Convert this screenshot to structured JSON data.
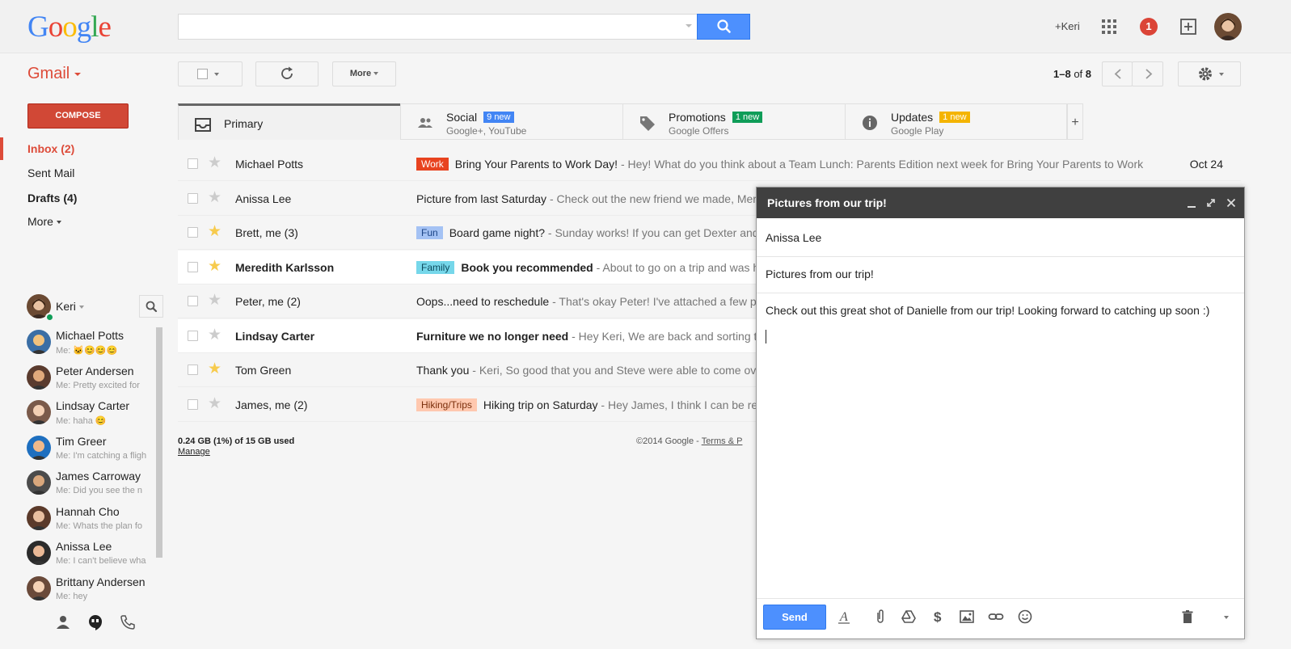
{
  "header": {
    "logo": "Google",
    "search": {
      "value": "",
      "placeholder": ""
    },
    "user_link": "+Keri",
    "notifications_count": "1"
  },
  "toolbar": {
    "app_label": "Gmail",
    "more_label": "More",
    "pager": {
      "range": "1–8",
      "of": "of",
      "total": "8"
    }
  },
  "nav": {
    "compose_label": "COMPOSE",
    "items": [
      {
        "label": "Inbox (2)",
        "active": true
      },
      {
        "label": "Sent Mail"
      },
      {
        "label": "Drafts (4)"
      },
      {
        "label": "More"
      }
    ]
  },
  "hangouts": {
    "me": "Keri",
    "contacts": [
      {
        "name": "Michael Potts",
        "message": "Me: 🐱😊😊😊"
      },
      {
        "name": "Peter Andersen",
        "message": "Me: Pretty excited for"
      },
      {
        "name": "Lindsay Carter",
        "message": "Me: haha 😊"
      },
      {
        "name": "Tim Greer",
        "message": "Me: I'm catching a fligh"
      },
      {
        "name": "James Carroway",
        "message": "Me: Did you see the n"
      },
      {
        "name": "Hannah Cho",
        "message": "Me: Whats the plan fo"
      },
      {
        "name": "Anissa Lee",
        "message": "Me: I can't believe wha"
      },
      {
        "name": "Brittany Andersen",
        "message": "Me: hey"
      }
    ]
  },
  "tabs": [
    {
      "label": "Primary",
      "sub": "",
      "badge": ""
    },
    {
      "label": "Social",
      "sub": "Google+, YouTube",
      "badge": "9 new",
      "badge_color": "#4285f4"
    },
    {
      "label": "Promotions",
      "sub": "Google Offers",
      "badge": "1 new",
      "badge_color": "#0f9d58"
    },
    {
      "label": "Updates",
      "sub": "Google Play",
      "badge": "1 new",
      "badge_color": "#f4b400"
    }
  ],
  "emails": [
    {
      "sender": "Michael Potts",
      "starred": false,
      "unread": false,
      "label": "Work",
      "label_bg": "#e8431f",
      "label_fg": "#ffffff",
      "subject": "Bring Your Parents to Work Day!",
      "snippet": " - Hey! What do you think about a Team Lunch: Parents Edition next week for Bring Your Parents to Work",
      "date": "Oct 24"
    },
    {
      "sender": "Anissa Lee",
      "starred": false,
      "unread": false,
      "label": "",
      "subject": "Picture from last Saturday",
      "snippet": " - Check out the new friend we made, Mer",
      "date": ""
    },
    {
      "sender": "Brett, me (3)",
      "starred": true,
      "unread": false,
      "label": "Fun",
      "label_bg": "#a4c2f4",
      "label_fg": "#1c4587",
      "subject": "Board game night?",
      "snippet": " - Sunday works! If you can get Dexter and",
      "date": ""
    },
    {
      "sender": "Meredith Karlsson",
      "starred": true,
      "unread": true,
      "label": "Family",
      "label_bg": "#76d7ea",
      "label_fg": "#0b4a5c",
      "subject": "Book you recommended",
      "snippet": " - About to go on a trip and was h",
      "date": ""
    },
    {
      "sender": "Peter, me (2)",
      "starred": false,
      "unread": false,
      "label": "",
      "subject": "Oops...need to reschedule",
      "snippet": " - That's okay Peter! I've attached a few pl",
      "date": ""
    },
    {
      "sender": "Lindsay Carter",
      "starred": false,
      "unread": true,
      "label": "",
      "subject": "Furniture we no longer need",
      "snippet": " - Hey Keri, We are back and sorting t",
      "date": ""
    },
    {
      "sender": "Tom Green",
      "starred": true,
      "unread": false,
      "label": "",
      "subject": "Thank you",
      "snippet": " - Keri, So good that you and Steve were able to come ove",
      "date": ""
    },
    {
      "sender": "James, me (2)",
      "starred": false,
      "unread": false,
      "label": "Hiking/Trips",
      "label_bg": "#ffc8af",
      "label_fg": "#7a2e0b",
      "subject": "Hiking trip on Saturday",
      "snippet": " - Hey James, I think I can be re",
      "date": ""
    }
  ],
  "footer": {
    "storage": "0.24 GB (1%) of 15 GB used",
    "manage": "Manage",
    "copyright": "©2014 Google - ",
    "terms": "Terms & P"
  },
  "compose": {
    "title": "Pictures from our trip!",
    "to": "Anissa Lee",
    "subject": "Pictures from our trip!",
    "body": "Check out this great shot of Danielle from our trip! Looking forward to catching up soon :)",
    "send_label": "Send"
  },
  "colors": {
    "accent_red": "#dd4b39",
    "compose_red": "#d14836",
    "blue": "#4d90fe"
  }
}
